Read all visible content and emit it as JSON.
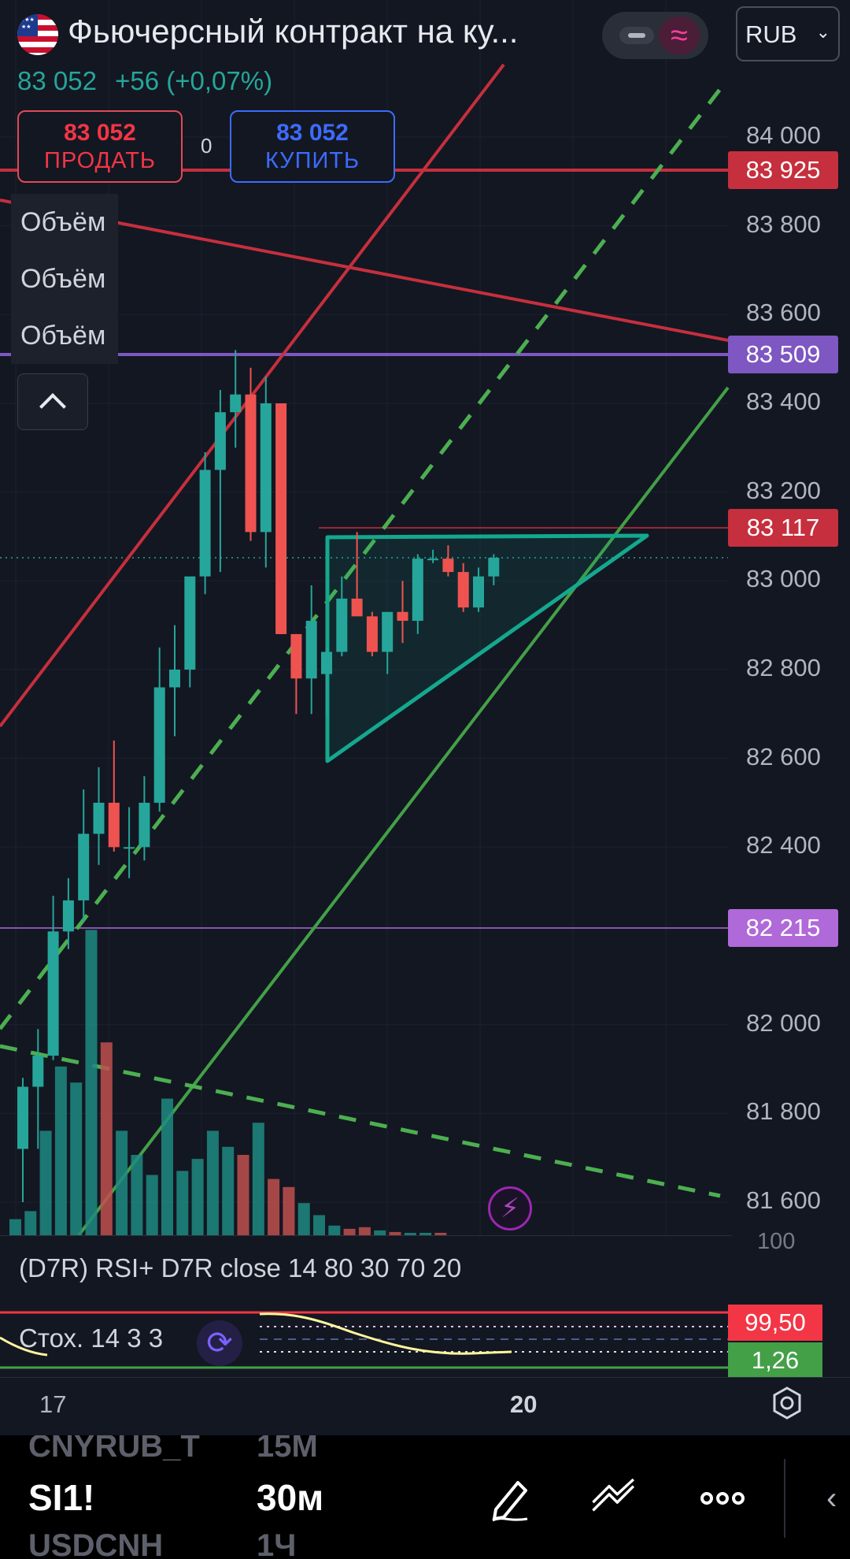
{
  "header": {
    "title": "Фьючерсный контракт на ку...",
    "currency": "RUB",
    "last_price": "83 052",
    "change": "+56 (+0,07%)"
  },
  "trade": {
    "sell_price": "83 052",
    "sell_label": "ПРОДАТЬ",
    "spread": "0",
    "buy_price": "83 052",
    "buy_label": "КУПИТЬ"
  },
  "indicators_left": [
    "Объём",
    "Объём",
    "Объём"
  ],
  "price_axis": {
    "ticks": [
      "84 000",
      "83 800",
      "83 600",
      "83 400",
      "83 200",
      "83 000",
      "82 800",
      "82 600",
      "82 400",
      "82 000",
      "81 800",
      "81 600"
    ],
    "tags": {
      "red_high": "83 925",
      "purple_high": "83 509",
      "red_level": "83 117",
      "purple_low": "82 215"
    }
  },
  "colors": {
    "up": "#26a69a",
    "down": "#ef5350",
    "red_line": "#c62f3d",
    "purple_line": "#7e57c2",
    "green_line": "#43a047",
    "triangle": "#14a88f"
  },
  "chart_data": {
    "type": "candlestick",
    "ylim": [
      81500,
      84150
    ],
    "candles": [
      {
        "o": 81720,
        "h": 81880,
        "l": 81600,
        "c": 81860
      },
      {
        "o": 81860,
        "h": 81990,
        "l": 81720,
        "c": 81930
      },
      {
        "o": 81930,
        "h": 82290,
        "l": 81920,
        "c": 82210
      },
      {
        "o": 82210,
        "h": 82330,
        "l": 82170,
        "c": 82280
      },
      {
        "o": 82280,
        "h": 82530,
        "l": 82230,
        "c": 82430
      },
      {
        "o": 82430,
        "h": 82580,
        "l": 82360,
        "c": 82500
      },
      {
        "o": 82500,
        "h": 82640,
        "l": 82390,
        "c": 82400
      },
      {
        "o": 82400,
        "h": 82490,
        "l": 82330,
        "c": 82400
      },
      {
        "o": 82400,
        "h": 82560,
        "l": 82370,
        "c": 82500
      },
      {
        "o": 82500,
        "h": 82850,
        "l": 82480,
        "c": 82760
      },
      {
        "o": 82760,
        "h": 82900,
        "l": 82650,
        "c": 82800
      },
      {
        "o": 82800,
        "h": 82990,
        "l": 82760,
        "c": 83010
      },
      {
        "o": 83010,
        "h": 83290,
        "l": 82970,
        "c": 83250
      },
      {
        "o": 83250,
        "h": 83430,
        "l": 83020,
        "c": 83380
      },
      {
        "o": 83380,
        "h": 83520,
        "l": 83300,
        "c": 83420
      },
      {
        "o": 83420,
        "h": 83480,
        "l": 83090,
        "c": 83110
      },
      {
        "o": 83110,
        "h": 83460,
        "l": 83030,
        "c": 83400
      },
      {
        "o": 83400,
        "h": 83400,
        "l": 82880,
        "c": 82880
      },
      {
        "o": 82880,
        "h": 82880,
        "l": 82700,
        "c": 82780
      },
      {
        "o": 82780,
        "h": 82990,
        "l": 82700,
        "c": 82910
      },
      {
        "o": 82790,
        "h": 82850,
        "l": 82700,
        "c": 82840
      },
      {
        "o": 82840,
        "h": 83010,
        "l": 82830,
        "c": 82960
      },
      {
        "o": 82960,
        "h": 83110,
        "l": 82960,
        "c": 82920
      },
      {
        "o": 82920,
        "h": 82930,
        "l": 82830,
        "c": 82840
      },
      {
        "o": 82840,
        "h": 82900,
        "l": 82790,
        "c": 82930
      },
      {
        "o": 82930,
        "h": 83000,
        "l": 82860,
        "c": 82910
      },
      {
        "o": 82910,
        "h": 83060,
        "l": 82880,
        "c": 83050
      },
      {
        "o": 83050,
        "h": 83070,
        "l": 83040,
        "c": 83050
      },
      {
        "o": 83050,
        "h": 83080,
        "l": 83010,
        "c": 83020
      },
      {
        "o": 83020,
        "h": 83040,
        "l": 82930,
        "c": 82940
      },
      {
        "o": 82940,
        "h": 83030,
        "l": 82930,
        "c": 83010
      },
      {
        "o": 83010,
        "h": 83060,
        "l": 82990,
        "c": 83052
      }
    ],
    "volume": [
      20,
      30,
      130,
      210,
      190,
      380,
      240,
      130,
      100,
      75,
      170,
      80,
      95,
      130,
      110,
      100,
      140,
      70,
      60,
      40,
      25,
      12,
      8,
      10,
      6,
      4,
      3,
      3,
      3
    ]
  },
  "rsi": {
    "label": "(D7R) RSI+ D7R close 14 80 30 70 20",
    "top_value": "100"
  },
  "stoch": {
    "label": "Стох. 14 3 3",
    "upper": "99,50",
    "lower": "1,26"
  },
  "time_axis": {
    "left": "17",
    "right": "20"
  },
  "toolbar": {
    "symbol": "SI1!",
    "timeframe": "30м",
    "ghost_top_symbol": "CNYRUB_T",
    "ghost_top_tf": "15М",
    "ghost_bottom_symbol": "USDCNH",
    "ghost_bottom_tf": "1Ч"
  }
}
